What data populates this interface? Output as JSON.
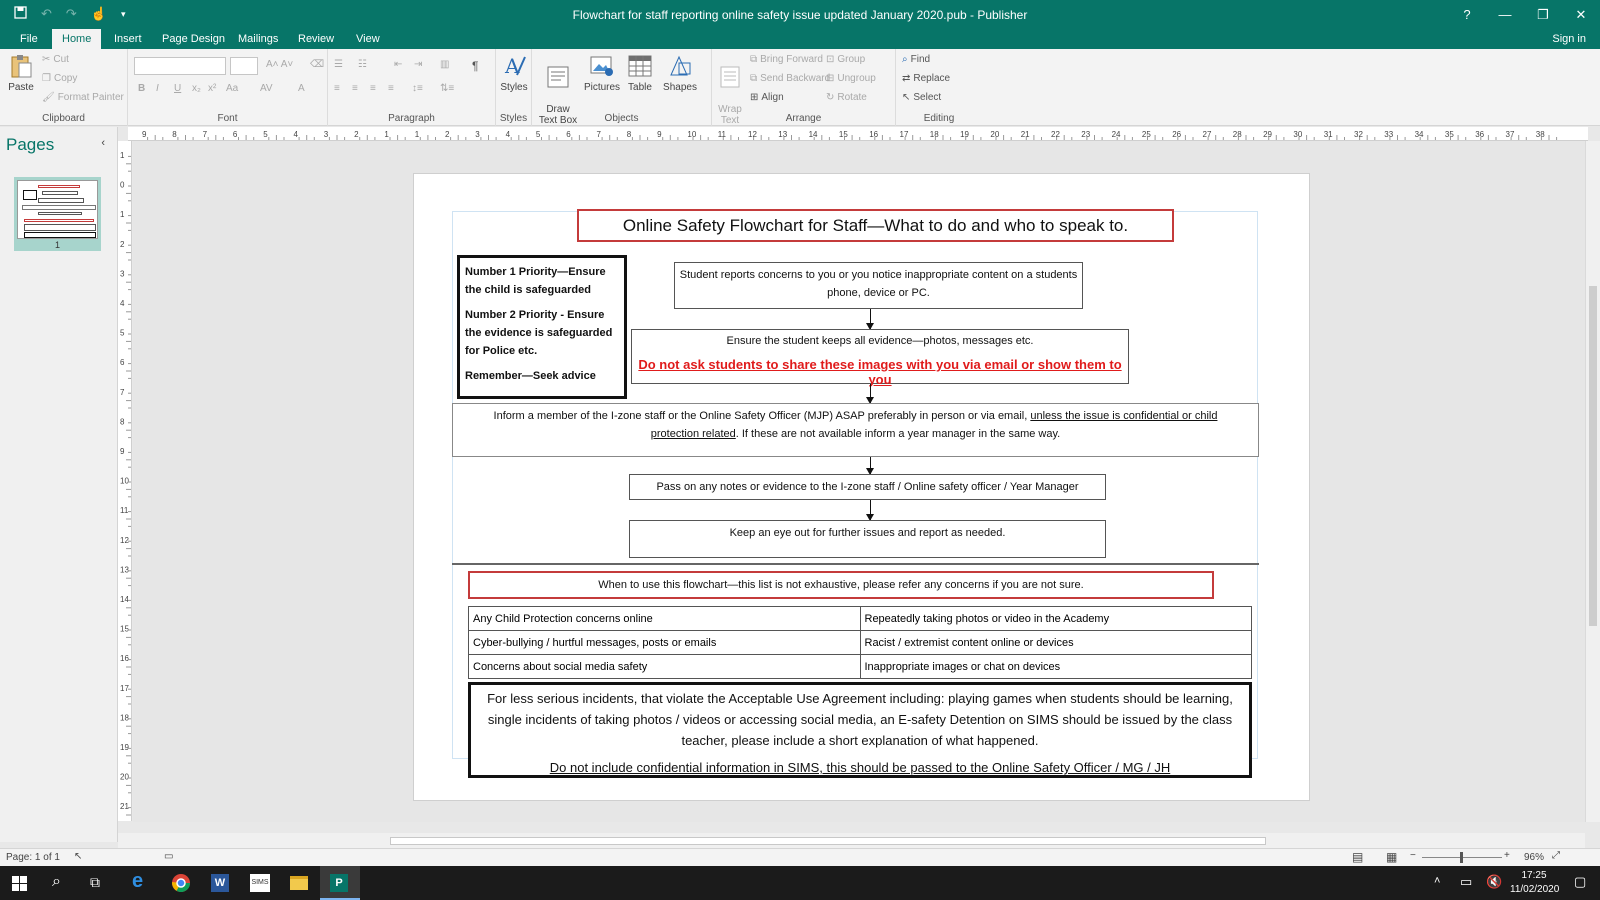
{
  "window": {
    "title": "Flowchart for staff reporting online safety issue updated January 2020.pub - Publisher",
    "help": "?",
    "minimize": "—",
    "restore": "❐",
    "close": "✕"
  },
  "tabs": [
    "File",
    "Home",
    "Insert",
    "Page Design",
    "Mailings",
    "Review",
    "View"
  ],
  "sign_in": "Sign in",
  "ribbon": {
    "clipboard": {
      "paste": "Paste",
      "cut": "Cut",
      "copy": "Copy",
      "format_painter": "Format Painter",
      "label": "Clipboard"
    },
    "font": {
      "label": "Font"
    },
    "paragraph": {
      "label": "Paragraph"
    },
    "styles": {
      "styles": "Styles",
      "label": "Styles"
    },
    "objects": {
      "draw_text_box": "Draw\nText Box",
      "pictures": "Pictures",
      "table": "Table",
      "shapes": "Shapes",
      "label": "Objects"
    },
    "arrange": {
      "wrap_text": "Wrap\nText",
      "bring_forward": "Bring Forward",
      "send_backward": "Send Backward",
      "align": "Align",
      "group": "Group",
      "ungroup": "Ungroup",
      "rotate": "Rotate",
      "label": "Arrange"
    },
    "editing": {
      "find": "Find",
      "replace": "Replace",
      "select": "Select",
      "label": "Editing"
    }
  },
  "pages_pane": {
    "title": "Pages",
    "page_number": "1"
  },
  "ruler_h": [
    "9",
    "8",
    "7",
    "6",
    "5",
    "4",
    "3",
    "2",
    "1",
    "1",
    "2",
    "3",
    "4",
    "5",
    "6",
    "7",
    "8",
    "9",
    "10",
    "11",
    "12",
    "13",
    "14",
    "15",
    "16",
    "17",
    "18",
    "19",
    "20",
    "21",
    "22",
    "23",
    "24",
    "25",
    "26",
    "27",
    "28",
    "29",
    "30",
    "31",
    "32",
    "33",
    "34",
    "35",
    "36",
    "37",
    "38"
  ],
  "ruler_v": [
    "1",
    "0",
    "1",
    "2",
    "3",
    "4",
    "5",
    "6",
    "7",
    "8",
    "9",
    "10",
    "11",
    "12",
    "13",
    "14",
    "15",
    "16",
    "17",
    "18",
    "19",
    "20",
    "21"
  ],
  "document": {
    "title": "Online Safety Flowchart for Staff—What to do and who to speak to.",
    "priority1": "Number 1 Priority—Ensure the child is safeguarded",
    "priority2": "Number 2 Priority - Ensure the evidence is safeguarded for Police etc.",
    "remember": "Remember—Seek advice",
    "step1": "Student reports concerns to you or you notice inappropriate content on a students phone, device or PC.",
    "step2": "Ensure the student keeps all evidence—photos, messages etc.",
    "step2_warning": "Do not ask students to share these images with you via email or show them to you",
    "step3_a": "Inform a member of the I-zone staff or the Online Safety Officer (MJP) ASAP preferably in person or via email, ",
    "step3_b": "unless the issue is confidential or child protection related",
    "step3_c": ". If these are not available inform a year manager in the same way.",
    "step4": "Pass on any notes or evidence to the I-zone staff / Online safety officer / Year  Manager",
    "step5": "Keep an eye out for further issues and report as needed.",
    "when_title": "When to use this flowchart—this list is not exhaustive, please refer any concerns if you are not sure.",
    "concerns": [
      [
        "Any Child Protection concerns online",
        "Repeatedly taking photos or video in the Academy"
      ],
      [
        "Cyber-bullying / hurtful messages, posts or emails",
        "Racist / extremist  content online or devices"
      ],
      [
        "Concerns about social media  safety",
        "Inappropriate images  or chat on devices"
      ]
    ],
    "less_serious": "For less serious incidents, that violate the Acceptable Use Agreement including: playing games when students should be learning, single incidents of taking photos / videos or accessing social media, an E-safety Detention on SIMS should be issued by the class teacher, please include a short explanation of what happened.",
    "confidential_note": "Do not include confidential information in SIMS, this should be passed to the Online Safety Officer / MG / JH"
  },
  "status": {
    "page": "Page: 1 of 1",
    "zoom": "96%",
    "zoom_percent": 96
  },
  "taskbar": {
    "time": "17:25",
    "date": "11/02/2020",
    "sims_label": "SIMS"
  },
  "colors": {
    "accent": "#077568",
    "red_border": "#c43b3b",
    "warning_red": "#e01b1b"
  }
}
